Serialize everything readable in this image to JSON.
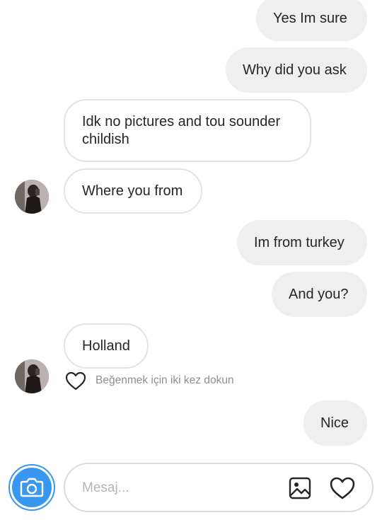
{
  "thread": {
    "messages": [
      {
        "id": "m1",
        "direction": "sent",
        "text": "Yes Im sure"
      },
      {
        "id": "m2",
        "direction": "sent",
        "text": "Why did you ask"
      },
      {
        "id": "m3",
        "direction": "received",
        "text": "Idk no pictures and tou sounder childish"
      },
      {
        "id": "m4",
        "direction": "received",
        "text": "Where you from"
      },
      {
        "id": "m5",
        "direction": "sent",
        "text": "Im from turkey"
      },
      {
        "id": "m6",
        "direction": "sent",
        "text": "And you?"
      },
      {
        "id": "m7",
        "direction": "received",
        "text": "Holland"
      },
      {
        "id": "m8",
        "direction": "sent",
        "text": "Nice"
      }
    ],
    "like_hint": "Beğenmek için iki kez dokun"
  },
  "composer": {
    "placeholder": "Mesaj...",
    "value": ""
  },
  "icons": {
    "camera": "camera-icon",
    "gallery": "image-gallery-icon",
    "like": "heart-icon"
  },
  "colors": {
    "accent": "#3897f0",
    "sent_bubble": "#efefef",
    "received_border": "#e3e3e3",
    "hint_text": "#8e8e8e"
  }
}
